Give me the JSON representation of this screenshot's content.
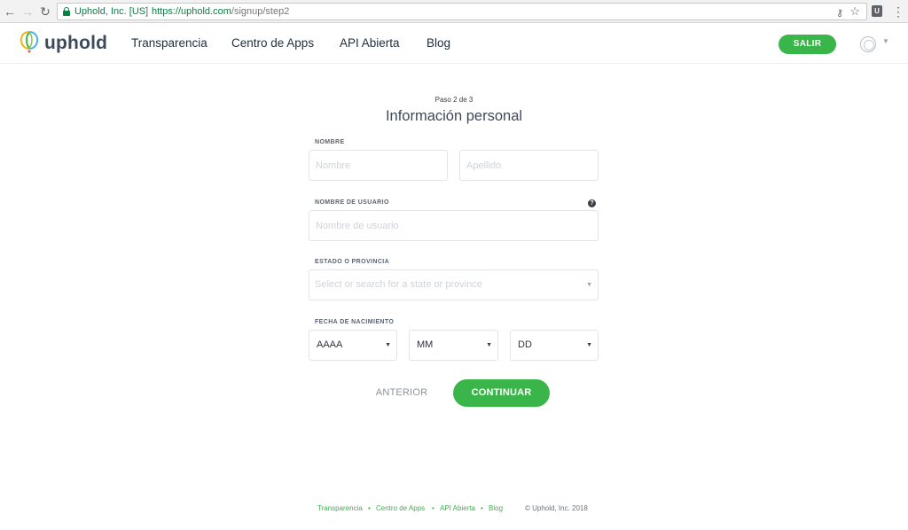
{
  "browser": {
    "site_identity": "Uphold, Inc. [US]",
    "url_host": "https://uphold.com",
    "url_path": "/signup/step2",
    "icons": [
      "back-icon",
      "forward-icon",
      "reload-icon",
      "lock-icon",
      "key-icon",
      "star-icon",
      "extension-icon",
      "menu-icon"
    ]
  },
  "header": {
    "logo_text": "uphold",
    "nav": [
      {
        "label": "Transparencia"
      },
      {
        "label": "Centro de Apps"
      },
      {
        "label": "API Abierta"
      },
      {
        "label": "Blog"
      }
    ],
    "exit_label": "SALIR",
    "accent_color": "#3ab54a"
  },
  "form": {
    "step": "Paso 2 de 3",
    "title": "Información personal",
    "name_label": "NOMBRE",
    "first_name_placeholder": "Nombre",
    "last_name_placeholder": "Apellido",
    "username_label": "NOMBRE DE USUARIO",
    "username_placeholder": "Nombre de usuario",
    "help_glyph": "?",
    "state_label": "ESTADO O PROVINCIA",
    "state_placeholder": "Select or search for a state or province",
    "birthdate_label": "FECHA DE NACIMIENTO",
    "year_value": "AAAA",
    "month_value": "MM",
    "day_value": "DD",
    "back_label": "ANTERIOR",
    "continue_label": "CONTINUAR"
  },
  "footer": {
    "links": [
      "Transparencia",
      "Centro de Apps",
      "API Abierta",
      "Blog"
    ],
    "copyright": "© Uphold, Inc. 2018"
  }
}
